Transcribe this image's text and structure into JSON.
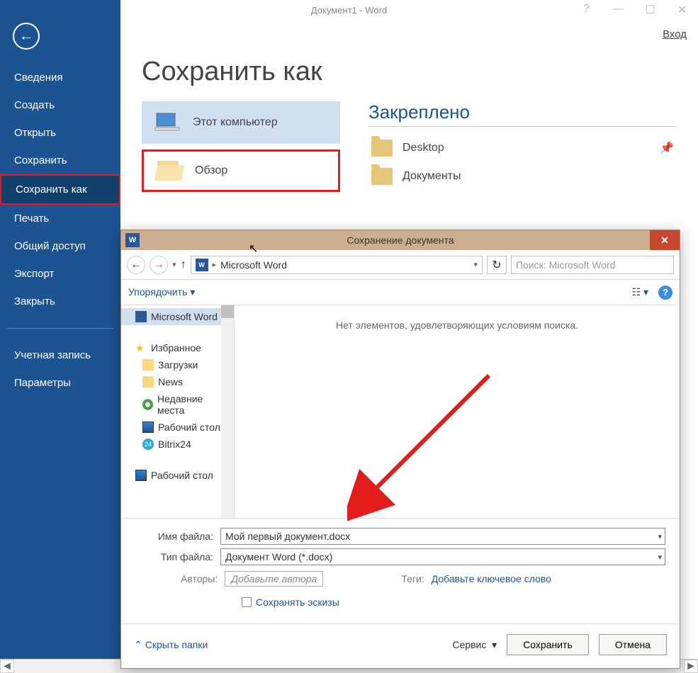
{
  "window": {
    "title": "Документ1 - Word",
    "signin": "Вход"
  },
  "sidebar": {
    "items": [
      "Сведения",
      "Создать",
      "Открыть",
      "Сохранить",
      "Сохранить как",
      "Печать",
      "Общий доступ",
      "Экспорт",
      "Закрыть"
    ],
    "after": [
      "Учетная запись",
      "Параметры"
    ]
  },
  "main": {
    "heading": "Сохранить как",
    "thisComputer": "Этот компьютер",
    "browse": "Обзор",
    "pinned": {
      "heading": "Закреплено",
      "items": [
        "Desktop",
        "Документы"
      ]
    }
  },
  "dialog": {
    "title": "Сохранение документа",
    "path": "Microsoft Word",
    "searchPlaceholder": "Поиск: Microsoft Word",
    "organize": "Упорядочить",
    "tree": {
      "root": "Microsoft Word",
      "fav": "Избранное",
      "items": [
        "Загрузки",
        "News",
        "Недавние места",
        "Рабочий стол",
        "Bitrix24"
      ],
      "desktop": "Рабочий стол"
    },
    "empty": "Нет элементов, удовлетворяющих условиям поиска.",
    "fields": {
      "filenameLabel": "Имя файла:",
      "filenameValue": "Мой первый документ.docx",
      "filetypeLabel": "Тип файла:",
      "filetypeValue": "Документ Word (*.docx)",
      "authorsLabel": "Авторы:",
      "authorsValue": "Добавьте автора",
      "tagsLabel": "Теги:",
      "tagsLink": "Добавьте ключевое слово",
      "thumbs": "Сохранять эскизы"
    },
    "footer": {
      "hide": "Скрыть папки",
      "service": "Сервис",
      "save": "Сохранить",
      "cancel": "Отмена"
    }
  }
}
